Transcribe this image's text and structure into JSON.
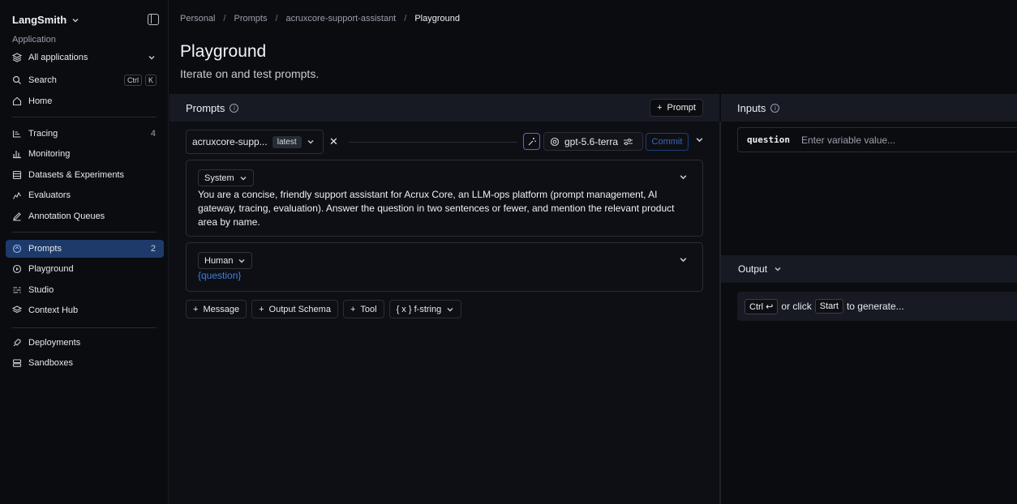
{
  "sidebar": {
    "brand": "LangSmith",
    "section_label": "Application",
    "app_selector": "All applications",
    "search": {
      "label": "Search",
      "kbd1": "Ctrl",
      "kbd2": "K"
    },
    "home": "Home",
    "group1": [
      {
        "label": "Tracing",
        "count": "4",
        "icon": "tracing-icon"
      },
      {
        "label": "Monitoring",
        "icon": "monitoring-icon"
      },
      {
        "label": "Datasets & Experiments",
        "icon": "datasets-icon"
      },
      {
        "label": "Evaluators",
        "icon": "evaluators-icon"
      },
      {
        "label": "Annotation Queues",
        "icon": "annotation-icon"
      }
    ],
    "group2": [
      {
        "label": "Prompts",
        "count": "2",
        "icon": "prompts-icon"
      },
      {
        "label": "Playground",
        "icon": "playground-icon"
      },
      {
        "label": "Studio",
        "icon": "studio-icon"
      },
      {
        "label": "Context Hub",
        "icon": "context-hub-icon"
      }
    ],
    "group3": [
      {
        "label": "Deployments",
        "icon": "deployments-icon"
      },
      {
        "label": "Sandboxes",
        "icon": "sandboxes-icon"
      }
    ]
  },
  "breadcrumb": [
    "Personal",
    "Prompts",
    "acruxcore-support-assistant",
    "Playground"
  ],
  "page": {
    "title": "Playground",
    "subtitle": "Iterate on and test prompts."
  },
  "prompts_panel": {
    "title": "Prompts",
    "add_prompt": "Prompt",
    "prompt_name": "acruxcore-supp...",
    "prompt_tag": "latest",
    "model": "gpt-5.6-terra",
    "commit": "Commit",
    "messages": [
      {
        "role": "System",
        "text": "You are a concise, friendly support assistant for Acrux Core, an LLM-ops platform (prompt management, AI gateway, tracing, evaluation). Answer the question in two sentences or fewer, and mention the relevant product area by name."
      },
      {
        "role": "Human",
        "text": "{question}"
      }
    ],
    "buttons": {
      "message": "Message",
      "output_schema": "Output Schema",
      "tool": "Tool",
      "format": "{ x } f-string"
    }
  },
  "inputs_panel": {
    "title": "Inputs",
    "variable": "question",
    "placeholder": "Enter variable value..."
  },
  "output_panel": {
    "title": "Output",
    "hint_kbd": "Ctrl ↩",
    "hint_mid": "or click",
    "hint_btn": "Start",
    "hint_end": "to generate..."
  }
}
